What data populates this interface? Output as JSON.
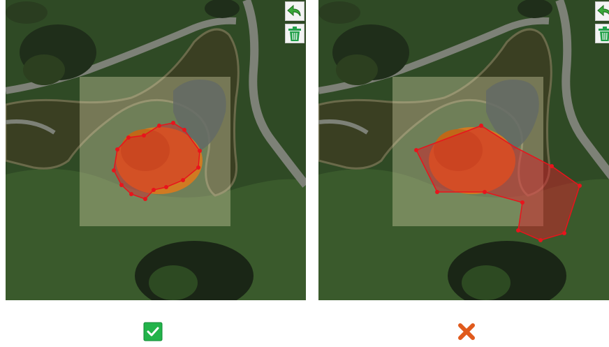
{
  "colors": {
    "grass": "#2f4a25",
    "grass_light": "#3f5e2f",
    "path": "#7d8177",
    "pond": "#3a3f22",
    "tree_dark": "#1f2e1a",
    "selection_box": "#e8e3b8",
    "polygon_fill": "#d6202a",
    "polygon_stroke": "#e8141c",
    "autumn_tree": "#d07a22",
    "ok_green": "#22b34a",
    "bad_red": "#e05a1c",
    "undo_green": "#3aa83a",
    "trash_green": "#22a04a"
  },
  "panels": [
    {
      "id": "correct",
      "result": "correct",
      "result_icon": "checkmark-icon"
    },
    {
      "id": "incorrect",
      "result": "incorrect",
      "result_icon": "cross-icon"
    }
  ],
  "tools": {
    "undo_icon": "undo-arrow-icon",
    "trash_icon": "trash-icon"
  }
}
